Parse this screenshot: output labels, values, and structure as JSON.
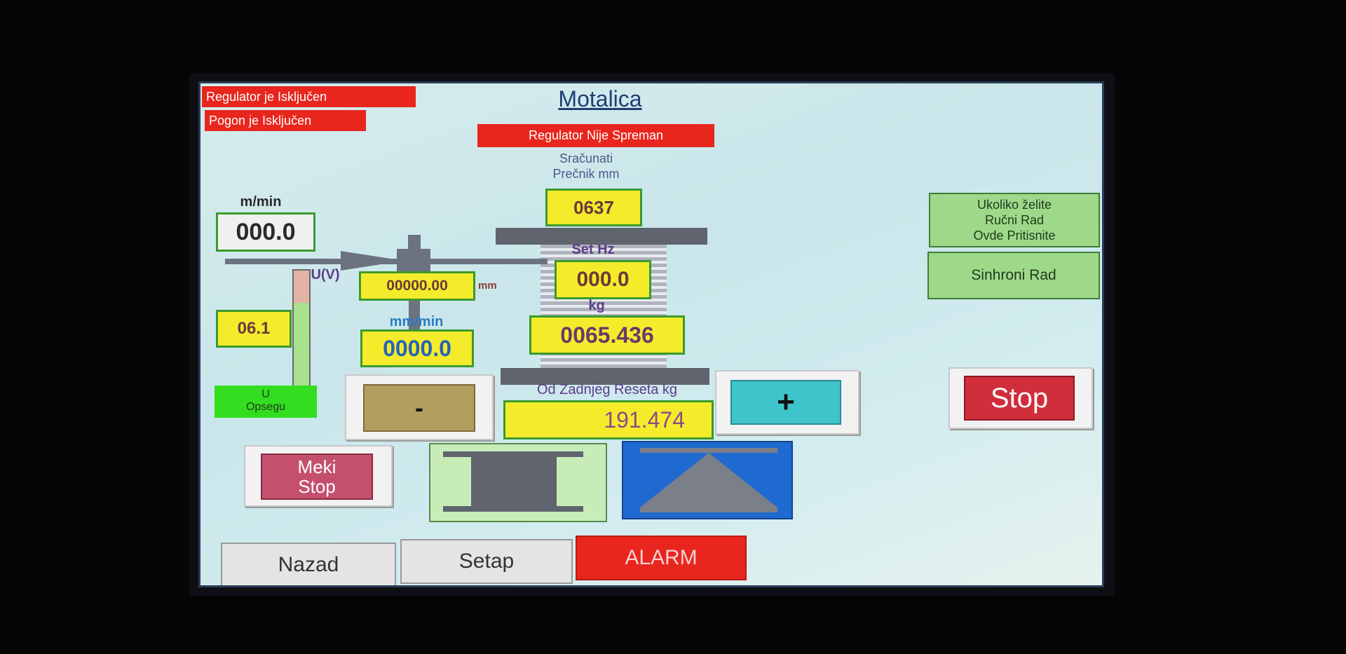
{
  "status": {
    "regulator_off": "Regulator je Isključen",
    "drive_off": "Pogon je Isključen",
    "regulator_not_ready": "Regulator Nije Spreman"
  },
  "title": "Motalica",
  "diameter": {
    "caption_line1": "Sračunati",
    "caption_line2": "Prečnik mm",
    "value": "0637"
  },
  "line_speed": {
    "unit": "m/min",
    "value": "000.0"
  },
  "voltage": {
    "label": "U(V)",
    "value": "06.1",
    "range_label_line1": "U",
    "range_label_line2": "Opsegu",
    "level_fraction": 0.72
  },
  "position": {
    "value": "00000.00",
    "unit": "mm"
  },
  "feed_speed": {
    "unit": "mm/min",
    "value": "0000.0"
  },
  "set_hz": {
    "label": "Set Hz",
    "value": "000.0"
  },
  "weight": {
    "unit": "kg",
    "value": "0065.436"
  },
  "reset_weight": {
    "caption": "Od Zadnjeg Reseta kg",
    "value": "191.474"
  },
  "buttons": {
    "minus": "-",
    "plus": "+",
    "stop": "Stop",
    "soft_stop_line1": "Meki",
    "soft_stop_line2": "Stop",
    "manual_line1": "Ukoliko želite",
    "manual_line2": "Ručni Rad",
    "manual_line3": "Ovde Pritisnite",
    "sync": "Sinhroni Rad"
  },
  "tabs": {
    "back": "Nazad",
    "setup": "Setap",
    "alarm": "ALARM"
  },
  "colors": {
    "alarm_red": "#e8261d",
    "value_yellow": "#f4ec2a",
    "frame_green": "#3b9a2e",
    "mode_green": "#9ed98a"
  }
}
